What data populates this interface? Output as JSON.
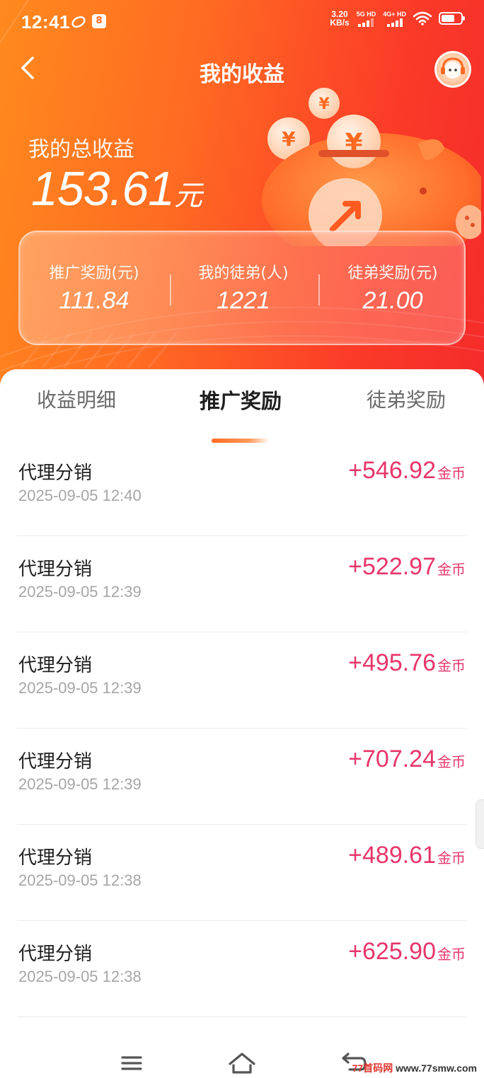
{
  "status_bar": {
    "time": "12:41",
    "net_speed_value": "3.20",
    "net_speed_unit": "KB/s",
    "sim1_label": "5G HD",
    "sim2_label": "4G+ HD",
    "icons": [
      "notification-icon",
      "app-badge-icon",
      "wifi-icon",
      "battery-icon"
    ]
  },
  "header": {
    "title": "我的收益",
    "back_icon": "chevron-left-icon",
    "service_icon": "customer-service-icon"
  },
  "summary": {
    "total_label": "我的总收益",
    "total_amount": "153.61",
    "total_unit": "元"
  },
  "stats": [
    {
      "label": "推广奖励(元)",
      "value": "111.84"
    },
    {
      "label": "我的徒弟(人)",
      "value": "1221"
    },
    {
      "label": "徒弟奖励(元)",
      "value": "21.00"
    }
  ],
  "tabs": [
    {
      "label": "收益明细",
      "active": false
    },
    {
      "label": "推广奖励",
      "active": true
    },
    {
      "label": "徒弟奖励",
      "active": false
    }
  ],
  "records": [
    {
      "title": "代理分销",
      "time": "2025-09-05 12:40",
      "amount": "+546.92",
      "unit": "金币"
    },
    {
      "title": "代理分销",
      "time": "2025-09-05 12:39",
      "amount": "+522.97",
      "unit": "金币"
    },
    {
      "title": "代理分销",
      "time": "2025-09-05 12:39",
      "amount": "+495.76",
      "unit": "金币"
    },
    {
      "title": "代理分销",
      "time": "2025-09-05 12:39",
      "amount": "+707.24",
      "unit": "金币"
    },
    {
      "title": "代理分销",
      "time": "2025-09-05 12:38",
      "amount": "+489.61",
      "unit": "金币"
    },
    {
      "title": "代理分销",
      "time": "2025-09-05 12:38",
      "amount": "+625.90",
      "unit": "金币"
    }
  ],
  "system_nav": {
    "menu_icon": "menu-icon",
    "home_icon": "home-icon",
    "back_icon": "back-icon"
  },
  "watermark": {
    "brand": "77首码网",
    "url": "www.77smw.com"
  },
  "colors": {
    "hero_start": "#ff8a1e",
    "hero_end": "#f42b2b",
    "amount": "#e8356a",
    "tab_indicator": "#ff6a22"
  }
}
